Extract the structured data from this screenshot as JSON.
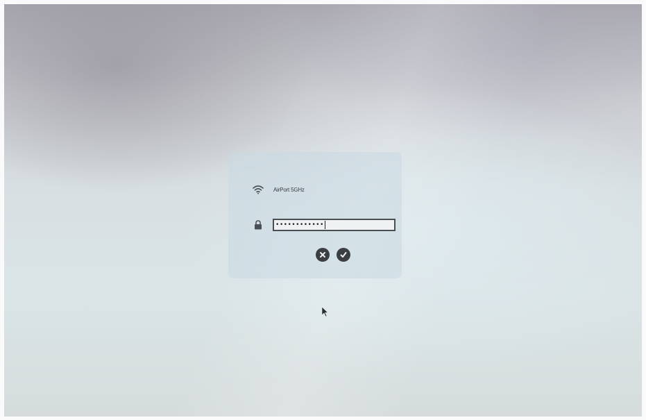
{
  "network": {
    "name": "AirPort 5GHz",
    "icon": "wifi-icon"
  },
  "password": {
    "masked_value": "••••••••••••",
    "icon": "lock-icon"
  },
  "actions": {
    "cancel_icon": "close-circle-icon",
    "confirm_icon": "checkmark-circle-icon"
  },
  "colors": {
    "panel": "#c8d8e1",
    "control_dark": "#3b3e42",
    "field_border": "#4a4d52"
  }
}
